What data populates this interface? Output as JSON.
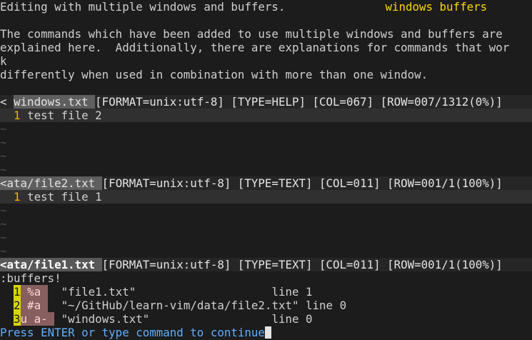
{
  "help_window": {
    "header_left": "Editing with multiple windows and buffers.",
    "header_tag": "windows buffers",
    "text_lines": [
      "The commands which have been added to use multiple windows and buffers are",
      "explained here.  Additionally, there are explanations for commands that wor",
      "k",
      "differently when used in combination with more than one window."
    ]
  },
  "status_help": {
    "prefix": "< ",
    "filename": "windows.txt ",
    "info": "[FORMAT=unix:utf-8] [TYPE=HELP] [COL=067] [ROW=007/1312(0%)]"
  },
  "window_file2": {
    "line_number": "1",
    "content": "test file 2",
    "tildes": [
      "~",
      "~",
      "~",
      "~"
    ]
  },
  "status_file2": {
    "filename": "<ata/file2.txt ",
    "info": "[FORMAT=unix:utf-8] [TYPE=TEXT] [COL=011] [ROW=001/1(100%)]"
  },
  "window_file1": {
    "line_number": "1",
    "content": "test file 1",
    "tildes": [
      "~",
      "~",
      "~",
      "~"
    ]
  },
  "status_file1": {
    "filename": "<ata/file1.txt ",
    "info": "[FORMAT=unix:utf-8] [TYPE=TEXT] [COL=011] [ROW=001/1(100%)]"
  },
  "command": {
    "entered": ":buffers!",
    "buffers": [
      {
        "num": "1",
        "flags": " %a ",
        "name": "\"file1.txt\"                    ",
        "line": "line 1"
      },
      {
        "num": "2",
        "flags": " #a ",
        "name": "\"~/GitHub/learn-vim/data/file2.txt\" ",
        "line": "line 0"
      },
      {
        "num": "3",
        "flags": "u a- ",
        "name": "\"windows.txt\"                  ",
        "line": "line 0"
      }
    ],
    "prompt": "Press ENTER or type command to continue"
  }
}
